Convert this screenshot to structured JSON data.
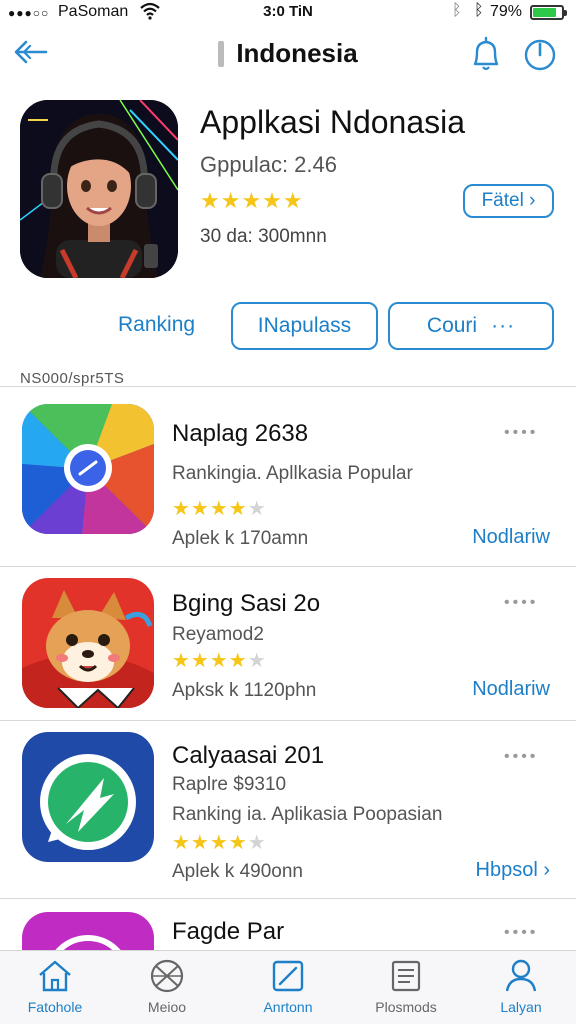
{
  "status_bar": {
    "signal": "●●●○○",
    "carrier": "PaSoman",
    "time": "3:0 TiN",
    "battery_pct": "79%"
  },
  "nav": {
    "title": "Indonesia",
    "back_icon": "back-arrow-icon",
    "right_icons": [
      "bell-icon",
      "power-icon"
    ]
  },
  "hero": {
    "title": "Applkasi Ndonasia",
    "subtitle": "Gppulac: 2.46",
    "stars": "★★★★★",
    "meta": "30 da: 300mnn",
    "fetch_label": "Fätel ›"
  },
  "tabs": {
    "ranking": "Ranking",
    "popular": "INapulass",
    "count": "Couri",
    "count_more": "···"
  },
  "section_label": "NS000/spr5TS",
  "list": [
    {
      "title": "Naplag 2638",
      "lines": [
        "Rankingia. Apllkasia Popular"
      ],
      "rating": 4.5,
      "stars_on": "★★★★",
      "stars_off": "★",
      "meta": "Aplek  k  170amn",
      "action": "Nodlariw",
      "more": "••••"
    },
    {
      "title": "Bging Sasi 2o",
      "lines": [
        "Reyamod2"
      ],
      "rating": 4,
      "stars_on": "★★★★",
      "stars_off": "★",
      "meta": "Apksk  k  1120phn",
      "action": "Nodlariw",
      "more": "••••"
    },
    {
      "title": "Calyaasai 201",
      "lines": [
        "Raplre $9310",
        "Ranking ia. Aplikasia Poopasian"
      ],
      "rating": 4,
      "stars_on": "★★★★",
      "stars_off": "★",
      "meta": "Aplek  k  490onn",
      "action": "Hbpsol ›",
      "more": "••••"
    },
    {
      "title": "Fagde Par",
      "lines": [],
      "more": "••••"
    }
  ],
  "tabbar": [
    {
      "label": "Fatohole",
      "icon": "home-icon",
      "color": "#1c7fc7"
    },
    {
      "label": "Meioo",
      "icon": "basketball-icon",
      "color": "#666666"
    },
    {
      "label": "Anrtonn",
      "icon": "edit-square-icon",
      "color": "#1c7fc7"
    },
    {
      "label": "Plosmods",
      "icon": "document-list-icon",
      "color": "#666666"
    },
    {
      "label": "Lalyan",
      "icon": "person-icon",
      "color": "#1c7fc7"
    }
  ],
  "colors": {
    "accent": "#1c7fc7",
    "star": "#f5c518",
    "battery": "#2ec84a"
  }
}
